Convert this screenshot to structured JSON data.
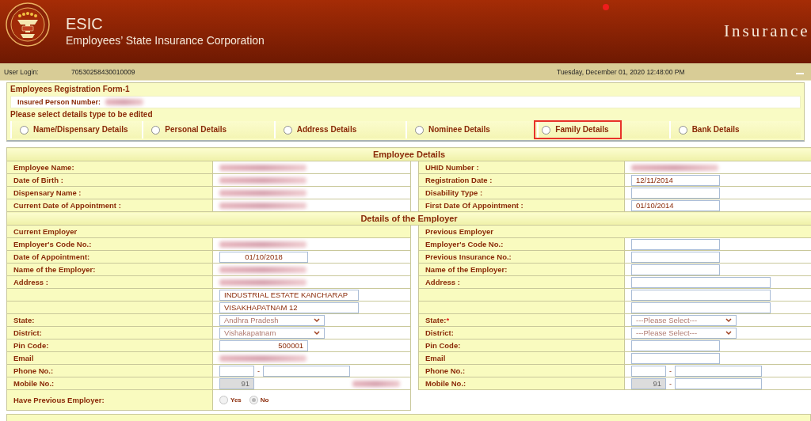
{
  "header": {
    "acronym": "ESIC",
    "name": "Employees’ State Insurance Corporation",
    "banner_text": "Insurance"
  },
  "info_bar": {
    "login_label": "User Login:",
    "login_value": "70530258430010009",
    "datetime": "Tuesday, December 01, 2020 12:48:00 PM"
  },
  "form": {
    "title": "Employees Registration Form-1",
    "ip_label": "Insured Person Number:",
    "ip_redacted": true,
    "prompt": "Please select details type to be edited",
    "options": [
      {
        "label": "Name/Dispensary Details",
        "selected": false
      },
      {
        "label": "Personal Details",
        "selected": false
      },
      {
        "label": "Address Details",
        "selected": false
      },
      {
        "label": "Nominee Details",
        "selected": false
      },
      {
        "label": "Family Details",
        "selected": false,
        "highlighted": true
      },
      {
        "label": "Bank Details",
        "selected": false
      }
    ]
  },
  "sections": [
    {
      "title": "Employee Details",
      "rows": [
        {
          "kind": "field",
          "left": {
            "label": "Employee Name:",
            "field": {
              "kind": "redacted"
            }
          },
          "right": {
            "label": "UHID Number :",
            "field": {
              "kind": "redacted"
            }
          }
        },
        {
          "kind": "field",
          "left": {
            "label": "Date of Birth :",
            "field": {
              "kind": "redacted"
            }
          },
          "right": {
            "label": "Registration Date :",
            "field": {
              "kind": "input",
              "value": "12/11/2014"
            }
          }
        },
        {
          "kind": "field",
          "left": {
            "label": "Dispensary Name :",
            "field": {
              "kind": "redacted"
            }
          },
          "right": {
            "label": "Disability Type :",
            "field": {
              "kind": "input"
            }
          }
        },
        {
          "kind": "field",
          "left": {
            "label": "Current Date of Appointment :",
            "field": {
              "kind": "redacted"
            }
          },
          "right": {
            "label": "First Date Of Appointment :",
            "field": {
              "kind": "input",
              "value": "01/10/2014"
            }
          }
        }
      ]
    },
    {
      "title": "Details of the Employer",
      "rows": [
        {
          "kind": "subheading",
          "left": "Current Employer",
          "right": "Previous Employer"
        },
        {
          "kind": "field",
          "left": {
            "label": "Employer's Code No.:",
            "field": {
              "kind": "redacted"
            }
          },
          "right": {
            "label": "Employer's Code No.:",
            "field": {
              "kind": "input"
            }
          }
        },
        {
          "kind": "field",
          "left": {
            "label": "Date of Appointment:",
            "field": {
              "kind": "input",
              "value": "01/10/2018",
              "centered": true
            }
          },
          "right": {
            "label": "Previous Insurance No.:",
            "field": {
              "kind": "input"
            }
          }
        },
        {
          "kind": "field",
          "left": {
            "label": "Name of the Employer:",
            "field": {
              "kind": "redacted"
            }
          },
          "right": {
            "label": "Name of the Employer:",
            "field": {
              "kind": "input"
            }
          }
        },
        {
          "kind": "field",
          "left": {
            "label": "Address :",
            "field": {
              "kind": "redacted"
            }
          },
          "right": {
            "label": "Address :",
            "field": {
              "kind": "wide_input"
            }
          }
        },
        {
          "kind": "field",
          "left": {
            "field": {
              "kind": "wide_input",
              "value": "INDUSTRIAL ESTATE KANCHARAP"
            }
          },
          "right": {
            "field": {
              "kind": "wide_input"
            }
          }
        },
        {
          "kind": "field",
          "left": {
            "field": {
              "kind": "wide_input",
              "value": "VISAKHAPATNAM 12"
            }
          },
          "right": {
            "field": {
              "kind": "wide_input"
            }
          }
        },
        {
          "kind": "field",
          "left": {
            "label": "State:",
            "field": {
              "kind": "select",
              "value": "Andhra Pradesh"
            }
          },
          "right": {
            "label": "State:",
            "required_mark": "*",
            "field": {
              "kind": "select",
              "value": "---Please Select---"
            }
          }
        },
        {
          "kind": "field",
          "left": {
            "label": "District:",
            "field": {
              "kind": "select",
              "value": "Vishakapatnam"
            }
          },
          "right": {
            "label": "District:",
            "field": {
              "kind": "select",
              "value": "---Please Select---"
            }
          }
        },
        {
          "kind": "field",
          "left": {
            "label": "Pin Code:",
            "field": {
              "kind": "input",
              "value": "500001",
              "right_aligned": true
            }
          },
          "right": {
            "label": "Pin Code:",
            "field": {
              "kind": "input"
            }
          }
        },
        {
          "kind": "field",
          "left": {
            "label": "Email",
            "field": {
              "kind": "redacted"
            }
          },
          "right": {
            "label": "Email",
            "field": {
              "kind": "input"
            }
          }
        },
        {
          "kind": "field",
          "left": {
            "label": "Phone No.:",
            "field": {
              "kind": "phone",
              "separator": "-"
            }
          },
          "right": {
            "label": "Phone No.:",
            "field": {
              "kind": "phone",
              "separator": "-"
            }
          }
        },
        {
          "kind": "field",
          "left": {
            "label": "Mobile No.:",
            "field": {
              "kind": "mobile_masked",
              "code": "91"
            }
          },
          "right": {
            "label": "Mobile No.:",
            "field": {
              "kind": "mobile",
              "code": "91",
              "separator": "-"
            }
          }
        }
      ]
    }
  ],
  "previous_employer": {
    "label": "Have Previous Employer:",
    "options": [
      {
        "label": "Yes",
        "selected": false,
        "disabled": true
      },
      {
        "label": "No",
        "selected": true,
        "disabled": true
      }
    ]
  }
}
